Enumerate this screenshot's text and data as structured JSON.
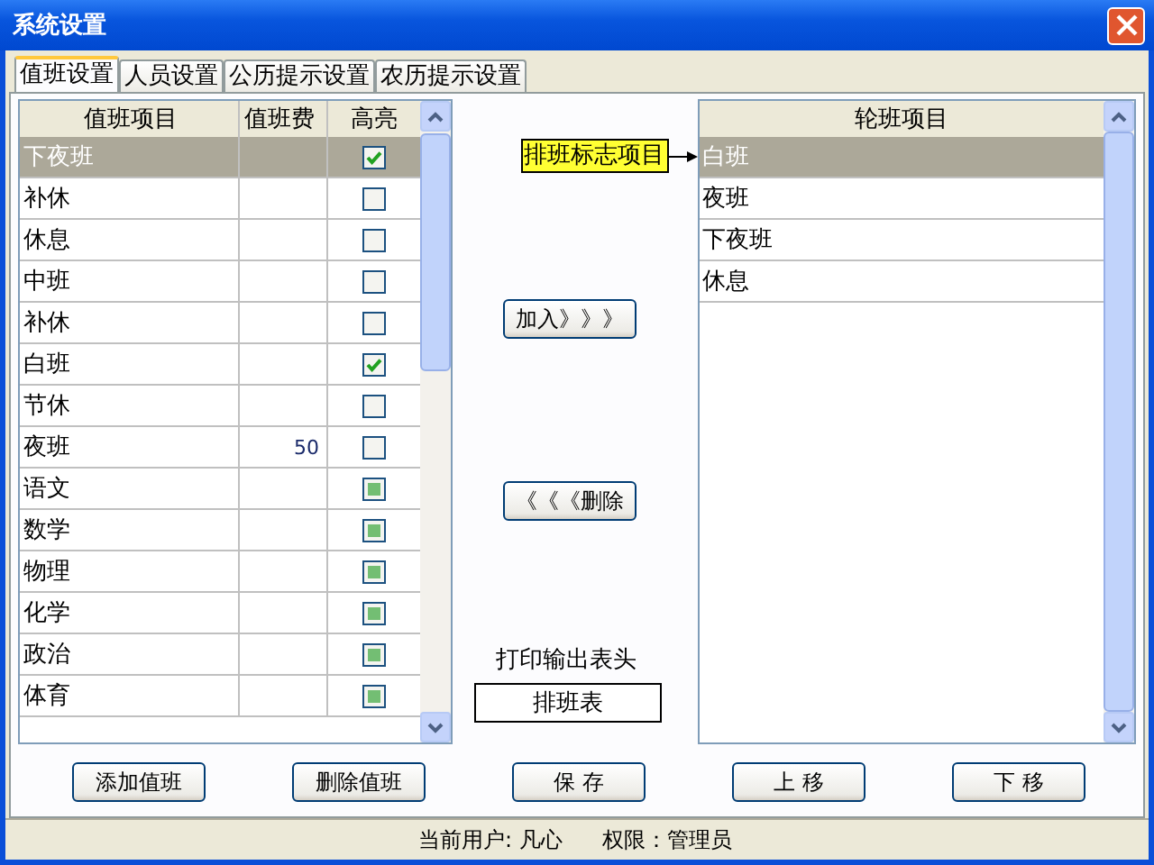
{
  "window": {
    "title": "系统设置"
  },
  "tabs": [
    {
      "label": "值班设置",
      "selected": true
    },
    {
      "label": "人员设置",
      "selected": false
    },
    {
      "label": "公历提示设置",
      "selected": false
    },
    {
      "label": "农历提示设置",
      "selected": false
    }
  ],
  "duty_table": {
    "columns": [
      "值班项目",
      "值班费",
      "高亮"
    ],
    "rows": [
      {
        "item": "下夜班",
        "checked": true,
        "indeterminate": false,
        "selected": true
      },
      {
        "item": "补休",
        "checked": false,
        "indeterminate": false,
        "selected": false
      },
      {
        "item": "休息",
        "checked": false,
        "indeterminate": false,
        "selected": false
      },
      {
        "item": "中班",
        "checked": false,
        "indeterminate": false,
        "selected": false
      },
      {
        "item": "补休",
        "checked": false,
        "indeterminate": false,
        "selected": false
      },
      {
        "item": "白班",
        "checked": true,
        "indeterminate": false,
        "selected": false
      },
      {
        "item": "节休",
        "checked": false,
        "indeterminate": false,
        "selected": false
      },
      {
        "item": "夜班",
        "fee": "50",
        "checked": false,
        "indeterminate": false,
        "selected": false
      },
      {
        "item": "语文",
        "checked": false,
        "indeterminate": true,
        "selected": false
      },
      {
        "item": "数学",
        "checked": false,
        "indeterminate": true,
        "selected": false
      },
      {
        "item": "物理",
        "checked": false,
        "indeterminate": true,
        "selected": false
      },
      {
        "item": "化学",
        "checked": false,
        "indeterminate": true,
        "selected": false
      },
      {
        "item": "政治",
        "checked": false,
        "indeterminate": true,
        "selected": false
      },
      {
        "item": "体育",
        "checked": false,
        "indeterminate": true,
        "selected": false
      }
    ]
  },
  "flag_label": "排班标志项目",
  "add_button": "加入》》》",
  "remove_button": "《《《删除",
  "print_header": {
    "label": "打印输出表头",
    "value": "排班表"
  },
  "rotation_list": {
    "column": "轮班项目",
    "rows": [
      {
        "item": "白班",
        "selected": true
      },
      {
        "item": "夜班",
        "selected": false
      },
      {
        "item": "下夜班",
        "selected": false
      },
      {
        "item": "休息",
        "selected": false
      }
    ]
  },
  "buttons": [
    "添加值班",
    "删除值班",
    "保 存",
    "上 移",
    "下 移"
  ],
  "status_bar": {
    "user": "当前用户: 凡心",
    "role": "权限：管理员"
  }
}
